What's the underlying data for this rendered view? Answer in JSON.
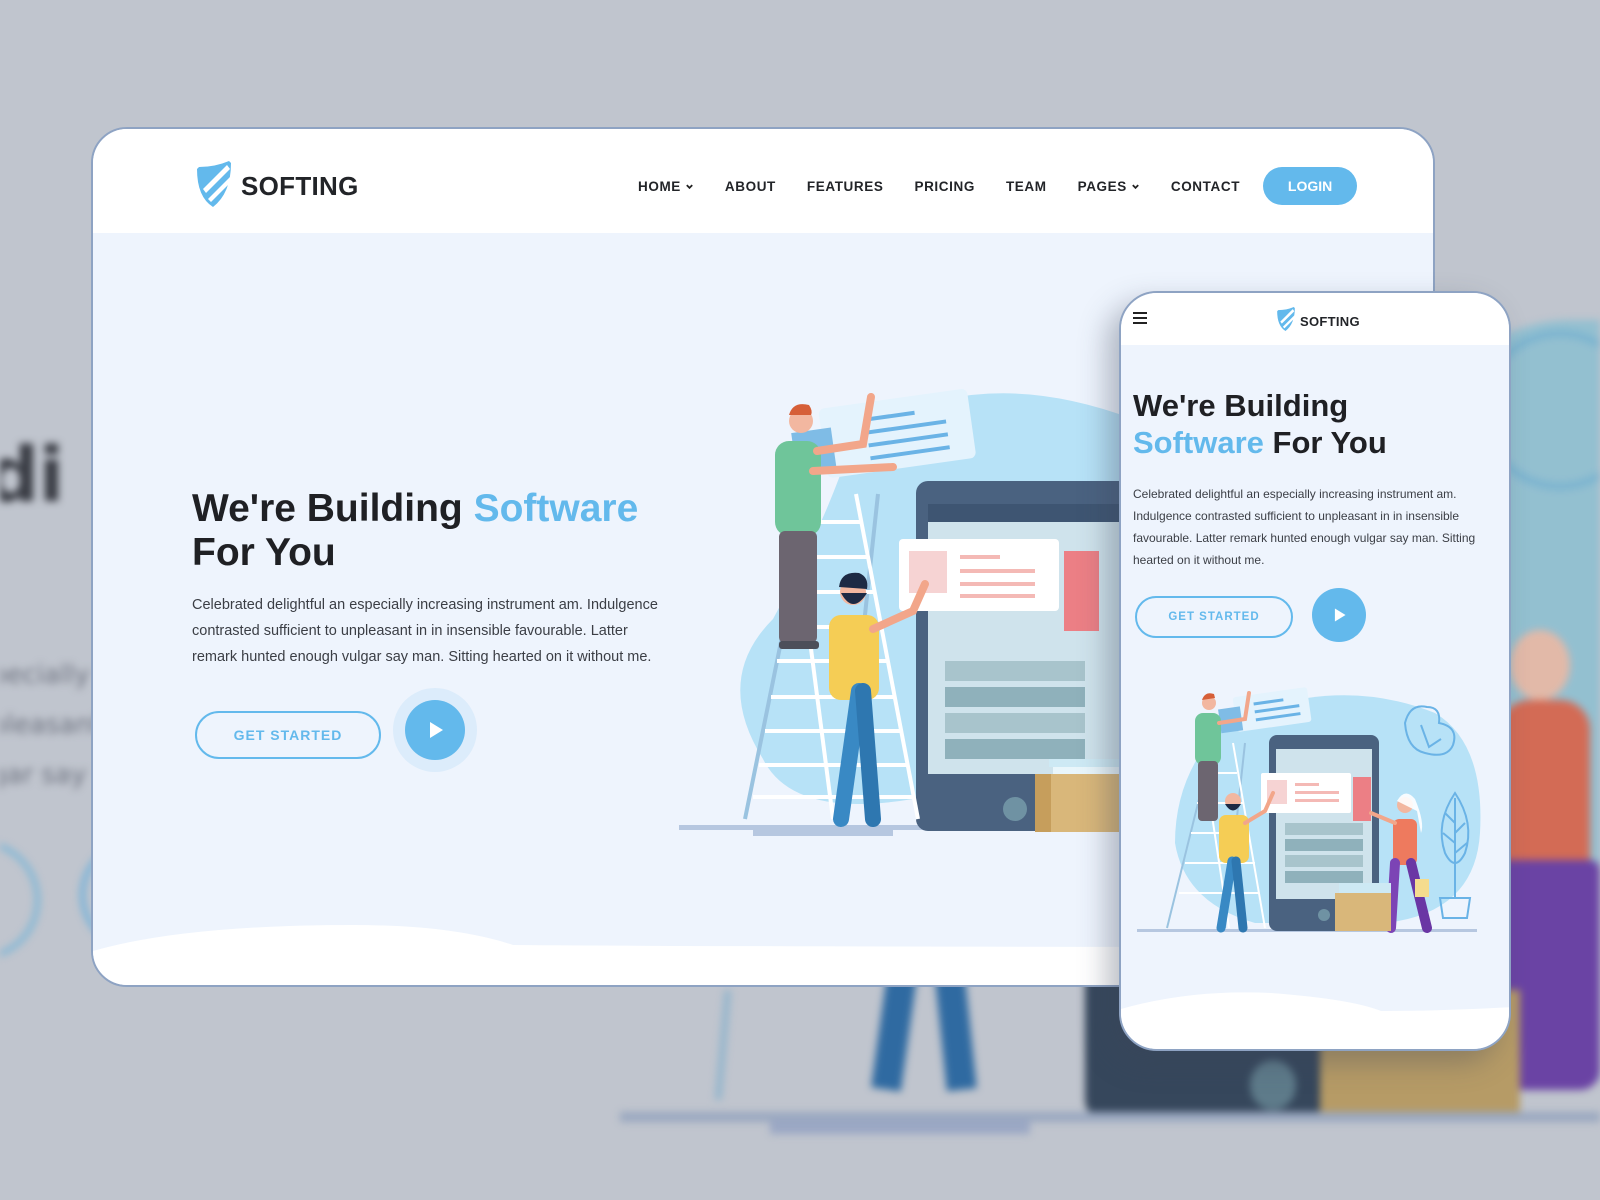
{
  "brand": {
    "name": "SOFTING",
    "logo_icon": "shield-icon",
    "accent_color": "#63b9ec",
    "text_color": "#1f2024"
  },
  "desktop": {
    "nav": {
      "items": [
        {
          "label": "HOME",
          "has_dropdown": true
        },
        {
          "label": "ABOUT",
          "has_dropdown": false
        },
        {
          "label": "FEATURES",
          "has_dropdown": false
        },
        {
          "label": "PRICING",
          "has_dropdown": false
        },
        {
          "label": "TEAM",
          "has_dropdown": false
        },
        {
          "label": "PAGES",
          "has_dropdown": true
        },
        {
          "label": "CONTACT",
          "has_dropdown": false
        }
      ],
      "login_label": "LOGIN"
    },
    "hero": {
      "title_part1": "We're Building ",
      "title_accent": "Software",
      "title_part2": "For You",
      "description": "Celebrated delightful an especially increasing instrument am. Indulgence contrasted sufficient to unpleasant in in insensible favourable. Latter remark hunted enough vulgar say man. Sitting hearted on it without me.",
      "cta_label": "GET STARTED",
      "play_icon": "play-icon"
    }
  },
  "mobile": {
    "menu_icon": "hamburger-menu-icon",
    "hero": {
      "title_part1": "We're Building",
      "title_accent": "Software",
      "title_part2": " For You",
      "description": "Celebrated delightful an especially increasing instrument am. Indulgence contrasted sufficient to unpleasant in in insensible favourable. Latter remark hunted enough vulgar say man. Sitting hearted on it without me.",
      "cta_label": "GET STARTED"
    }
  },
  "background": {
    "blurred_heading_fragment": "ldi",
    "blurred_text_lines": [
      "pecially",
      "pleasant",
      "gar say"
    ]
  }
}
